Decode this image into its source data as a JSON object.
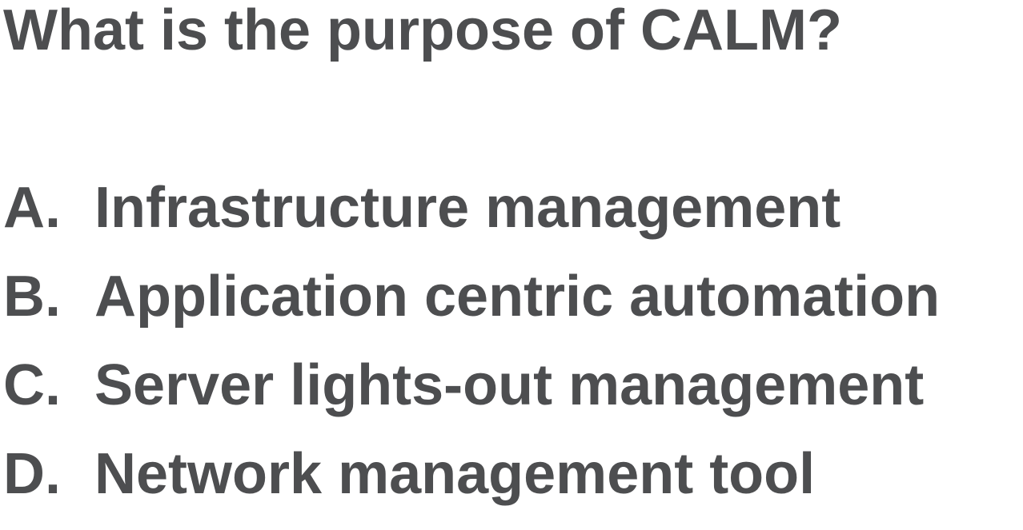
{
  "question": {
    "text": "What is the purpose of CALM?"
  },
  "options": [
    {
      "letter": "A.",
      "text": "Infrastructure management"
    },
    {
      "letter": "B.",
      "text": "Application centric automation"
    },
    {
      "letter": "C.",
      "text": "Server lights-out management"
    },
    {
      "letter": "D.",
      "text": "Network management tool"
    }
  ],
  "colors": {
    "text": "#4d4e50",
    "background": "#ffffff"
  }
}
